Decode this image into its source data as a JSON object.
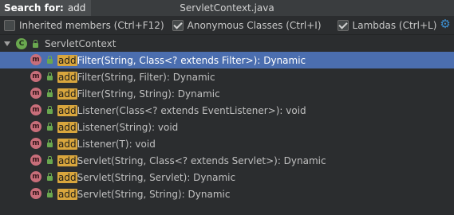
{
  "search": {
    "label": "Search for:",
    "value": "add"
  },
  "window": {
    "title": "ServletContext.java"
  },
  "options": [
    {
      "label": "Inherited members (Ctrl+F12)",
      "checked": false
    },
    {
      "label": "Anonymous Classes (Ctrl+I)",
      "checked": true
    },
    {
      "label": "Lambdas (Ctrl+L)",
      "checked": true
    }
  ],
  "settings_icon": "gear-icon",
  "tree": {
    "root": {
      "icon": "class-icon",
      "label": "ServletContext"
    },
    "methods": [
      {
        "match": "add",
        "rest": "Filter(String, Class<? extends Filter>): Dynamic",
        "selected": true
      },
      {
        "match": "add",
        "rest": "Filter(String, Filter): Dynamic"
      },
      {
        "match": "add",
        "rest": "Filter(String, String): Dynamic"
      },
      {
        "match": "add",
        "rest": "Listener(Class<? extends EventListener>): void"
      },
      {
        "match": "add",
        "rest": "Listener(String): void"
      },
      {
        "match": "add",
        "rest": "Listener(T): void"
      },
      {
        "match": "add",
        "rest": "Servlet(String, Class<? extends Servlet>): Dynamic"
      },
      {
        "match": "add",
        "rest": "Servlet(String, Servlet): Dynamic"
      },
      {
        "match": "add",
        "rest": "Servlet(String, String): Dynamic"
      }
    ]
  },
  "colors": {
    "selection": "#4b6eaf",
    "highlight": "#d9a63d",
    "method_icon": "#c86e7a",
    "class_icon": "#6aa84f"
  }
}
